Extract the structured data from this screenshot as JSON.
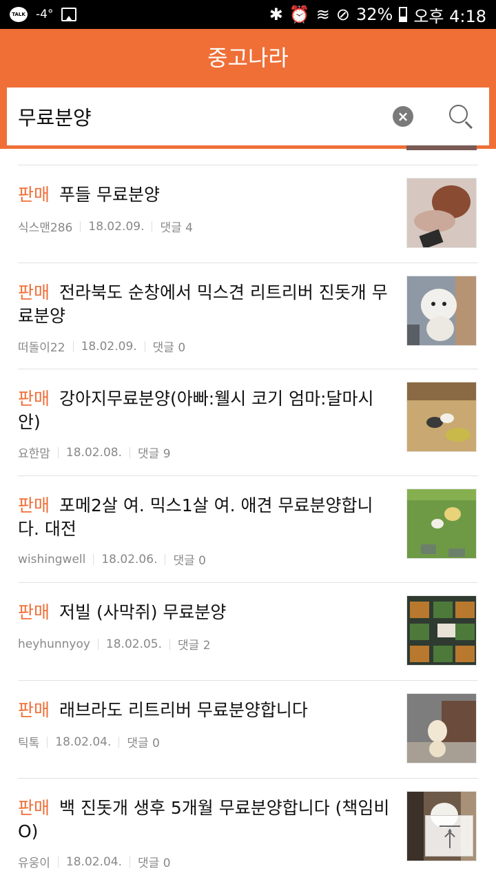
{
  "status_bar": {
    "talk_label": "TALK",
    "temperature": "-4°",
    "battery": "32%",
    "time": "오후 4:18"
  },
  "app": {
    "title": "중고나라"
  },
  "search": {
    "query": "무료분양"
  },
  "listings": [
    {
      "tag": "판매",
      "title": "푸들 무료분양",
      "author": "식스맨286",
      "date": "18.02.09.",
      "comments": "댓글 4",
      "thumb_colors": [
        "#d6c8c0",
        "#8a4b33",
        "#caa99a",
        "#2b2b2b"
      ]
    },
    {
      "tag": "판매",
      "title": "전라북도 순창에서 믹스견 리트리버 진돗개 무료분양",
      "author": "떠돌이22",
      "date": "18.02.09.",
      "comments": "댓글 0",
      "thumb_colors": [
        "#8e99a5",
        "#f2f0ec",
        "#5a5f66",
        "#b69373"
      ]
    },
    {
      "tag": "판매",
      "title": "강아지무료분양(아빠:웰시 코기 엄마:달마시안)",
      "author": "요한맘",
      "date": "18.02.08.",
      "comments": "댓글 9",
      "thumb_colors": [
        "#c9a971",
        "#8a6a44",
        "#3a3a3a",
        "#c8b94a"
      ]
    },
    {
      "tag": "판매",
      "title": "포메2살 여. 믹스1살 여. 애견 무료분양합니다. 대전",
      "author": "wishingwell",
      "date": "18.02.06.",
      "comments": "댓글 0",
      "thumb_colors": [
        "#6e9a46",
        "#86b050",
        "#e8d27a",
        "#6c7f6a"
      ]
    },
    {
      "tag": "판매",
      "title": "저빌 (사막쥐) 무료분양",
      "author": "heyhunnyoy",
      "date": "18.02.05.",
      "comments": "댓글 2",
      "thumb_colors": [
        "#2f3a30",
        "#b8792e",
        "#4d7a3a",
        "#e9e2d6"
      ]
    },
    {
      "tag": "판매",
      "title": "래브라도 리트리버 무료분양합니다",
      "author": "틱톡",
      "date": "18.02.04.",
      "comments": "댓글 0",
      "thumb_colors": [
        "#7d7d7d",
        "#a89f94",
        "#f1e7d3",
        "#6b4b3b"
      ]
    },
    {
      "tag": "판매",
      "title": "백 진돗개 생후 5개월 무료분양합니다 (책임비 O)",
      "author": "유웅이",
      "date": "18.02.04.",
      "comments": "댓글 0",
      "thumb_colors": [
        "#6e5a48",
        "#a89176",
        "#f2f0ea",
        "#3b3129"
      ]
    }
  ],
  "colors": {
    "accent": "#ef6f37",
    "meta_text": "#888888",
    "divider": "#e1e1e1"
  }
}
